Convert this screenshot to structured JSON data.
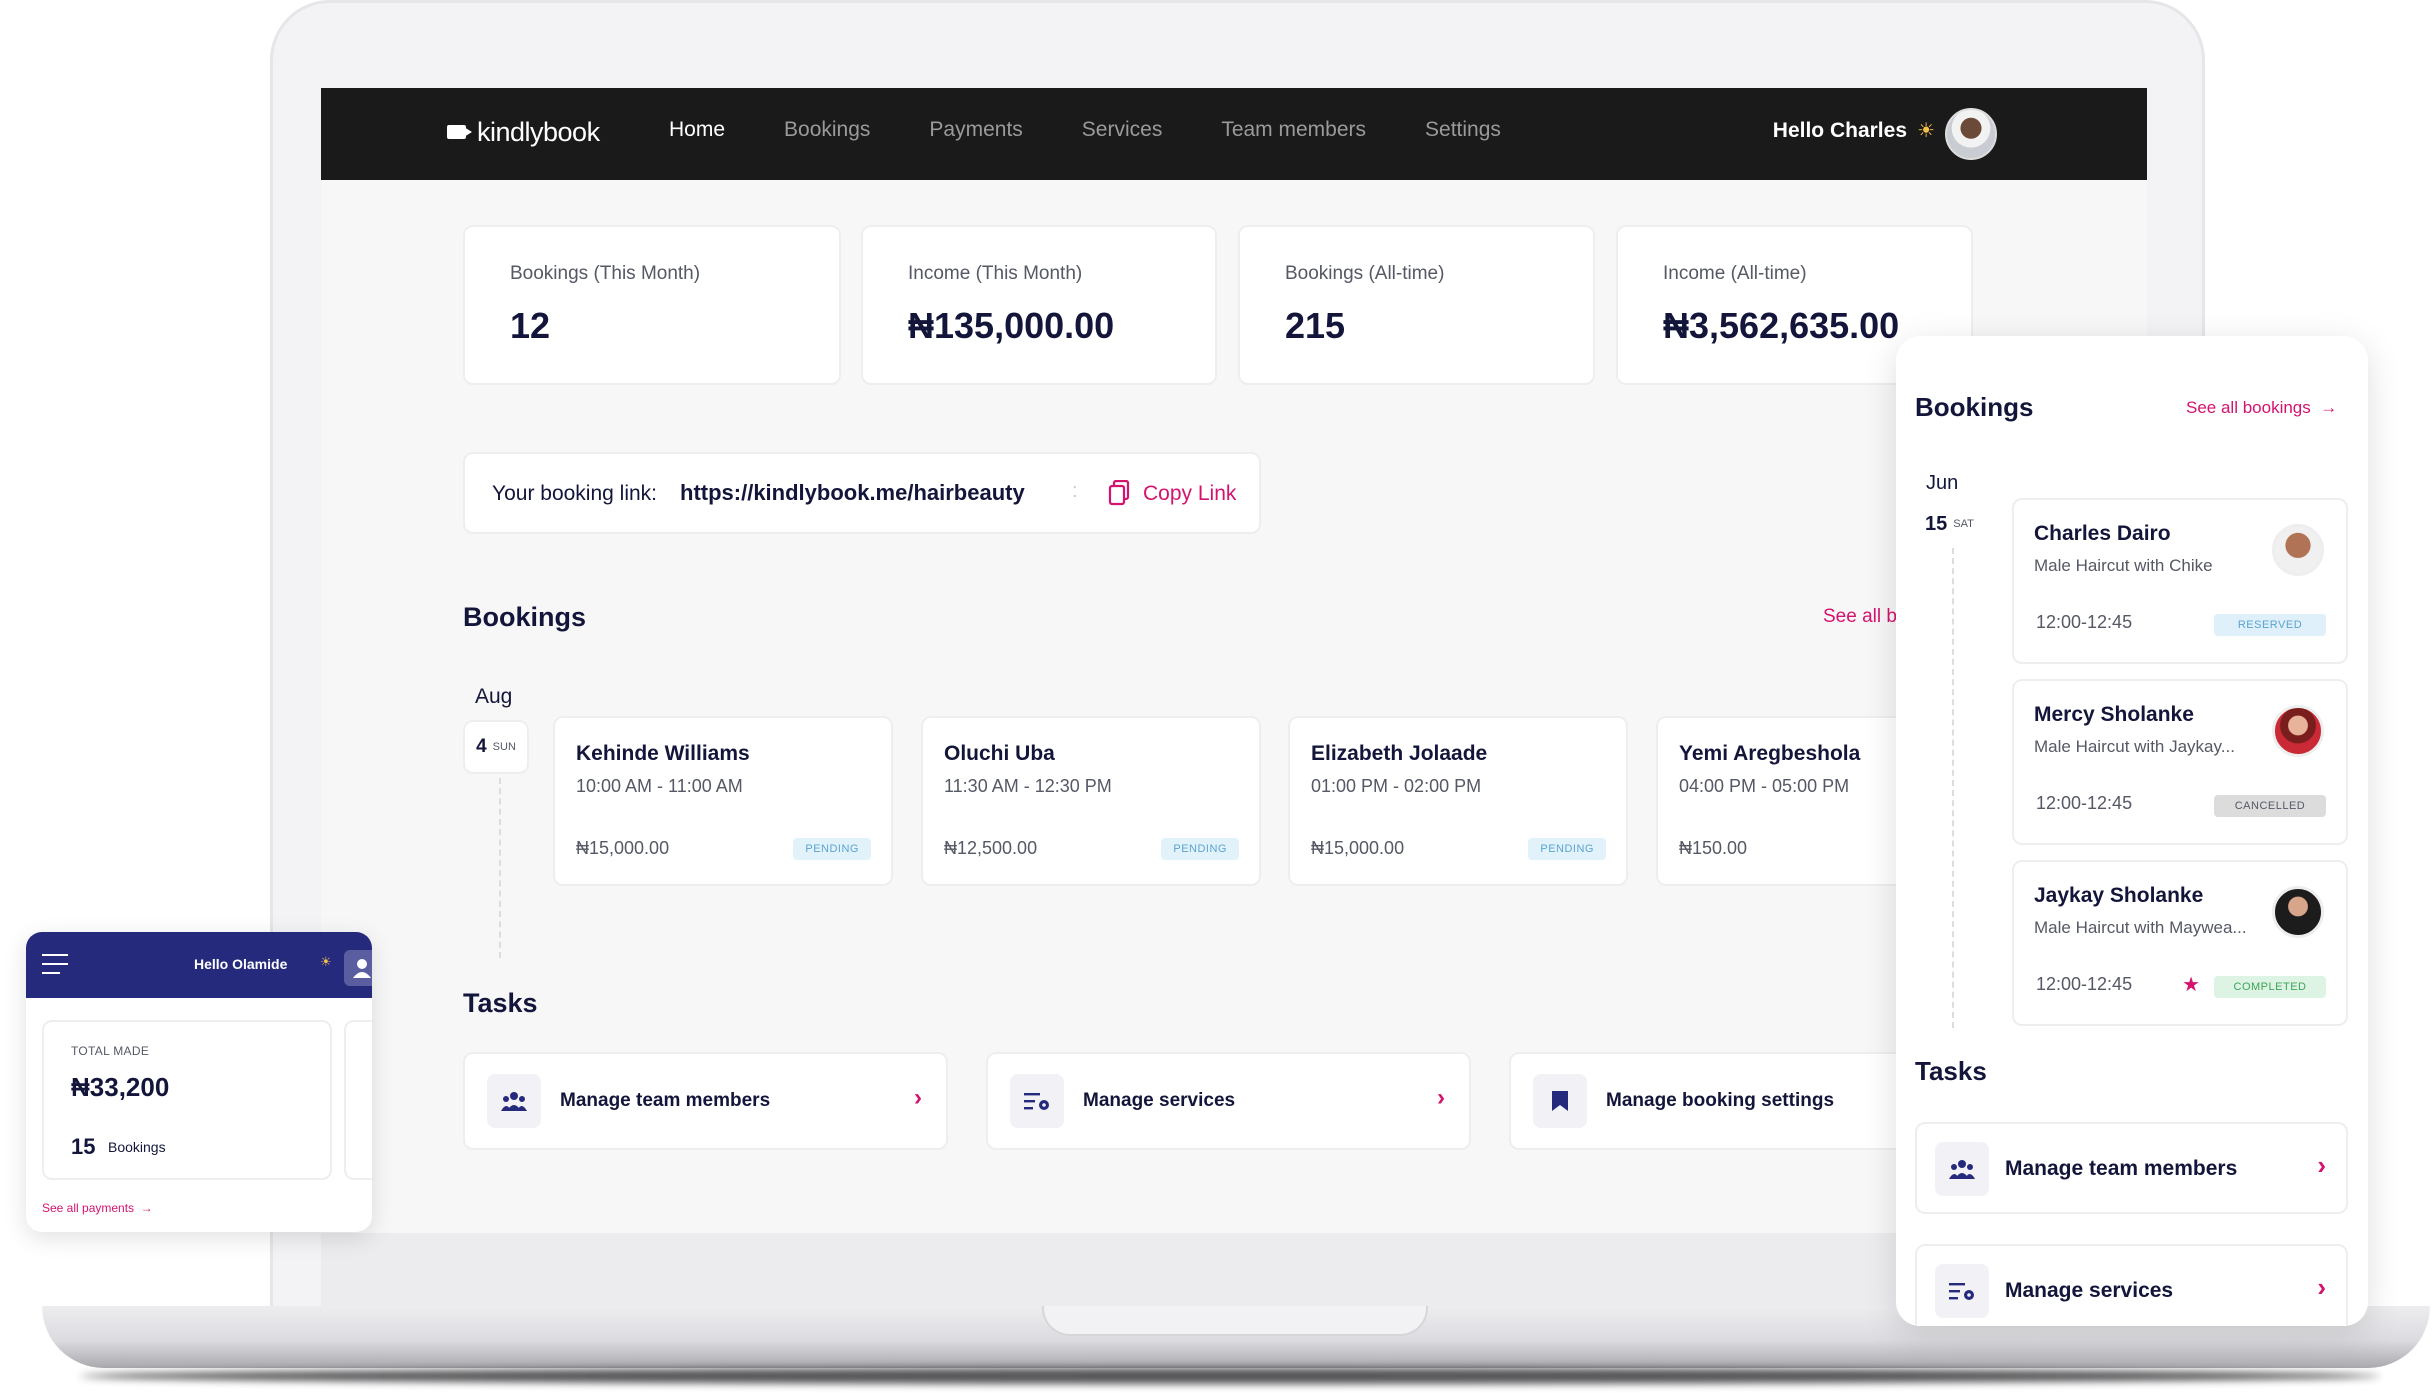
{
  "nav": {
    "logo": "kindlybook",
    "items": [
      "Home",
      "Bookings",
      "Payments",
      "Services",
      "Team members",
      "Settings"
    ],
    "active": "Home",
    "greeting": "Hello Charles",
    "greeting_icon": "sun-cloud-icon"
  },
  "stats": [
    {
      "label": "Bookings (This Month)",
      "value": "12"
    },
    {
      "label": "Income (This Month)",
      "value": "₦135,000.00"
    },
    {
      "label": "Bookings (All-time)",
      "value": "215"
    },
    {
      "label": "Income (All-time)",
      "value": "₦3,562,635.00"
    }
  ],
  "booking_link": {
    "label": "Your booking link:",
    "url": "https://kindlybook.me/hairbeauty",
    "copy_label": "Copy Link"
  },
  "bookings_section": {
    "title": "Bookings",
    "see_all": "See all b",
    "month": "Aug",
    "day": "4",
    "weekday": "SUN",
    "items": [
      {
        "name": "Kehinde Williams",
        "time": "10:00 AM - 11:00 AM",
        "price": "₦15,000.00",
        "status": "PENDING"
      },
      {
        "name": "Oluchi Uba",
        "time": "11:30 AM - 12:30 PM",
        "price": "₦12,500.00",
        "status": "PENDING"
      },
      {
        "name": "Elizabeth Jolaade",
        "time": "01:00 PM - 02:00 PM",
        "price": "₦15,000.00",
        "status": "PENDING"
      },
      {
        "name": "Yemi Aregbeshola",
        "time": "04:00 PM - 05:00 PM",
        "price": "₦150.00",
        "status": ""
      }
    ]
  },
  "tasks_section": {
    "title": "Tasks",
    "items": [
      {
        "label": "Manage team members",
        "icon": "team-icon"
      },
      {
        "label": "Manage services",
        "icon": "services-icon"
      },
      {
        "label": "Manage booking settings",
        "icon": "bookmark-icon"
      }
    ]
  },
  "mobile": {
    "greeting": "Hello Olamide",
    "total_label": "TOTAL MADE",
    "total_value": "₦33,200",
    "bookings_count": "15",
    "bookings_label": "Bookings",
    "see_all": "See all payments"
  },
  "panel": {
    "title": "Bookings",
    "see_all": "See all bookings",
    "month": "Jun",
    "day": "15",
    "weekday": "SAT",
    "items": [
      {
        "name": "Charles Dairo",
        "service": "Male Haircut with Chike",
        "time": "12:00-12:45",
        "status": "RESERVED"
      },
      {
        "name": "Mercy Sholanke",
        "service": "Male Haircut with Jaykay...",
        "time": "12:00-12:45",
        "status": "CANCELLED"
      },
      {
        "name": "Jaykay Sholanke",
        "service": "Male Haircut with Maywea...",
        "time": "12:00-12:45",
        "status": "COMPLETED"
      }
    ],
    "tasks_title": "Tasks",
    "tasks": [
      {
        "label": "Manage team members",
        "icon": "team-icon"
      },
      {
        "label": "Manage services",
        "icon": "services-icon"
      }
    ]
  },
  "colors": {
    "accent": "#d4136e",
    "navy": "#13163a",
    "nav_bg": "#1a1a1a",
    "mobile_header": "#262a7c",
    "pending_bg": "#e2f2fb",
    "reserved_bg": "#dff0fb",
    "cancelled_bg": "#dcdcdc",
    "completed_bg": "#ddf3e3"
  }
}
